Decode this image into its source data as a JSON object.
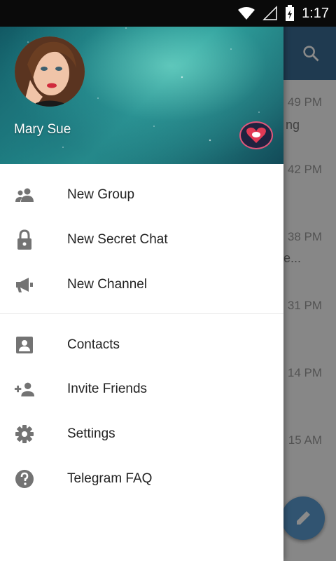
{
  "status_bar": {
    "time": "1:17"
  },
  "background_chat": {
    "times": [
      "49 PM",
      "42 PM",
      "38 PM",
      "31 PM",
      "14 PM",
      "15 AM"
    ],
    "snippets": [
      "ng",
      "",
      "e...",
      "",
      "",
      ""
    ]
  },
  "drawer": {
    "user_name": "Mary Sue",
    "menu": [
      {
        "label": "New Group",
        "icon": "group-icon"
      },
      {
        "label": "New Secret Chat",
        "icon": "lock-icon"
      },
      {
        "label": "New Channel",
        "icon": "megaphone-icon"
      },
      {
        "label": "Contacts",
        "icon": "contact-icon"
      },
      {
        "label": "Invite Friends",
        "icon": "add-person-icon"
      },
      {
        "label": "Settings",
        "icon": "gear-icon"
      },
      {
        "label": "Telegram FAQ",
        "icon": "help-icon"
      }
    ]
  },
  "colors": {
    "icon_gray": "#737373",
    "toolbar_blue": "#3a6c94",
    "fab_blue": "#5b9bd1"
  }
}
